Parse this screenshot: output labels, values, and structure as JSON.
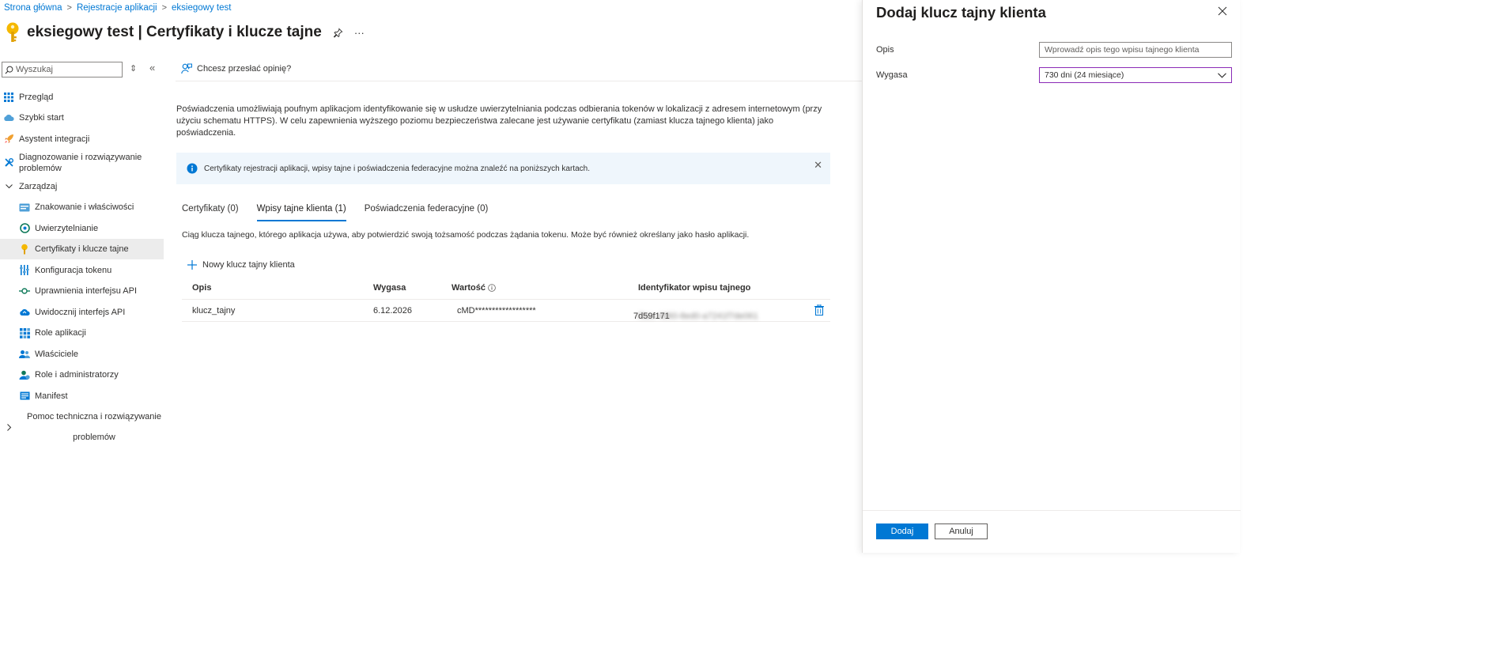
{
  "breadcrumb": {
    "items": [
      "Strona główna",
      "Rejestracje aplikacji",
      "eksiegowy test"
    ],
    "separator": ">"
  },
  "header": {
    "app_name": "eksiegowy test",
    "section": " | Certyfikaty i klucze tajne",
    "more": "···",
    "key_icon": "key-icon",
    "pin_icon": "pin-icon"
  },
  "sidebar": {
    "search_placeholder": "Wyszukaj",
    "sort_glyph": "⇕",
    "collapse_glyph": "«",
    "items": [
      {
        "label": "Przegląd",
        "icon": "overview-grid-icon"
      },
      {
        "label": "Szybki start",
        "icon": "cloud-quickstart-icon"
      },
      {
        "label": "Asystent integracji",
        "icon": "rocket-icon"
      },
      {
        "label": "Diagnozowanie i rozwiązywanie",
        "label2": "problemów",
        "icon": "wrench-icon"
      },
      {
        "label": "Zarządzaj",
        "icon": "chevron-down-icon"
      },
      {
        "label": "Znakowanie i właściwości",
        "icon": "branding-icon"
      },
      {
        "label": "Uwierzytelnianie",
        "icon": "authentication-icon"
      },
      {
        "label": "Certyfikaty i klucze tajne",
        "icon": "key-icon"
      },
      {
        "label": "Konfiguracja tokenu",
        "icon": "token-bars-icon"
      },
      {
        "label": "Uprawnienia interfejsu API",
        "icon": "api-permissions-icon"
      },
      {
        "label": "Uwidocznij interfejs API",
        "icon": "expose-api-cloud-icon"
      },
      {
        "label": "Role aplikacji",
        "icon": "app-roles-grid-icon"
      },
      {
        "label": "Właściciele",
        "icon": "owners-icon"
      },
      {
        "label": "Role i administratorzy",
        "icon": "roles-admins-icon"
      },
      {
        "label": "Manifest",
        "icon": "manifest-icon"
      },
      {
        "label": "Pomoc techniczna i rozwiązywanie",
        "label2": "problemów",
        "icon": "chevron-right-icon"
      }
    ]
  },
  "main": {
    "feedback": "Chcesz przesłać opinię?",
    "intro": "Poświadczenia umożliwiają poufnym aplikacjom identyfikowanie się w usłudze uwierzytelniania podczas odbierania tokenów w lokalizacji z adresem internetowym (przy użyciu schematu HTTPS). W celu zapewnienia wyższego poziomu bezpieczeństwa zalecane jest używanie certyfikatu (zamiast klucza tajnego klienta) jako poświadczenia.",
    "info_bar": "Certyfikaty rejestracji aplikacji, wpisy tajne i poświadczenia federacyjne można znaleźć na poniższych kartach.",
    "info_close": "✕",
    "tabs": [
      {
        "label": "Certyfikaty (0)",
        "active": false
      },
      {
        "label": "Wpisy tajne klienta (1)",
        "active": true
      },
      {
        "label": "Poświadczenia federacyjne (0)",
        "active": false
      }
    ],
    "tab_description": "Ciąg klucza tajnego, którego aplikacja używa, aby potwierdzić swoją tożsamość podczas żądania tokenu. Może być również określany jako hasło aplikacji.",
    "new_secret_label": "Nowy klucz tajny klienta",
    "table": {
      "headers": {
        "opis": "Opis",
        "wygasa": "Wygasa",
        "wartosc": "Wartość",
        "identyfikator": "Identyfikator wpisu tajnego"
      },
      "rows": [
        {
          "opis": "klucz_tajny",
          "wygasa": "6.12.2026",
          "wartosc": "cMD******************",
          "id_visible": "7d59f171",
          "id_blurred": "-f3ec-4860-8ed0-a7241f7de061"
        }
      ]
    }
  },
  "panel": {
    "title": "Dodaj klucz tajny klienta",
    "close": "✕",
    "description_label": "Opis",
    "description_placeholder": "Wprowadź opis tego wpisu tajnego klienta",
    "expires_label": "Wygasa",
    "expires_value": "730 dni (24 miesiące)",
    "add_button": "Dodaj",
    "cancel_button": "Anuluj"
  },
  "colors": {
    "accent": "#0078d4",
    "select_border": "#8a2bb7",
    "info_background": "#eff6fc",
    "key_yellow": "#f5b800"
  }
}
